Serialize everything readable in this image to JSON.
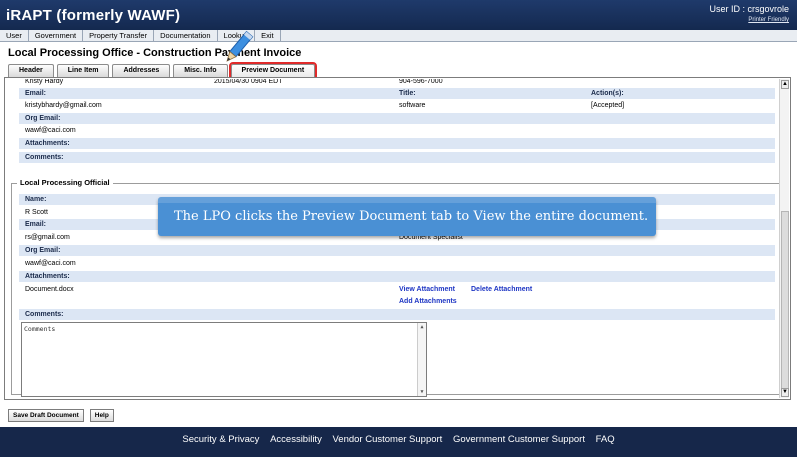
{
  "app": {
    "title": "iRAPT (formerly WAWF)",
    "user_id": "User ID : crsgovrole",
    "printer_friendly": "Printer Friendly"
  },
  "menu": [
    "User",
    "Government",
    "Property Transfer",
    "Documentation",
    "Lookup",
    "Exit"
  ],
  "page_title": "Local Processing Office - Construction Payment Invoice",
  "tabs": [
    "Header",
    "Line Item",
    "Addresses",
    "Misc. Info",
    "Preview Document"
  ],
  "top_section": {
    "partial_row": {
      "name": "Kristy Hardy",
      "date": "2015/04/30 0904 EDT",
      "phone": "904-596-7000"
    },
    "email_label": "Email:",
    "title_label": "Title:",
    "actions_label": "Action(s):",
    "email_value": "kristybhardy@gmail.com",
    "title_value": "software",
    "action_value": "[Accepted]",
    "org_email_label": "Org Email:",
    "org_email_value": "wawf@caci.com",
    "attachments_label": "Attachments:",
    "comments_label": "Comments:"
  },
  "lpo_section": {
    "legend": "Local Processing Official",
    "name_label": "Name:",
    "name_value": "R Scott",
    "email_label": "Email:",
    "email_value": "rs@gmail.com",
    "title_value": "Document Specialist",
    "org_email_label": "Org Email:",
    "org_email_value": "wawf@caci.com",
    "attachments_label": "Attachments:",
    "attachment_file": "Document.docx",
    "view_attachment": "View Attachment",
    "delete_attachment": "Delete Attachment",
    "add_attachments": "Add Attachments",
    "comments_label": "Comments:",
    "comments_placeholder": "Comments"
  },
  "callout_text": "The LPO clicks the Preview Document tab to View the entire document.",
  "buttons": {
    "save_draft": "Save Draft Document",
    "help": "Help"
  },
  "footer": [
    "Security & Privacy",
    "Accessibility",
    "Vendor Customer Support",
    "Government Customer Support",
    "FAQ"
  ]
}
